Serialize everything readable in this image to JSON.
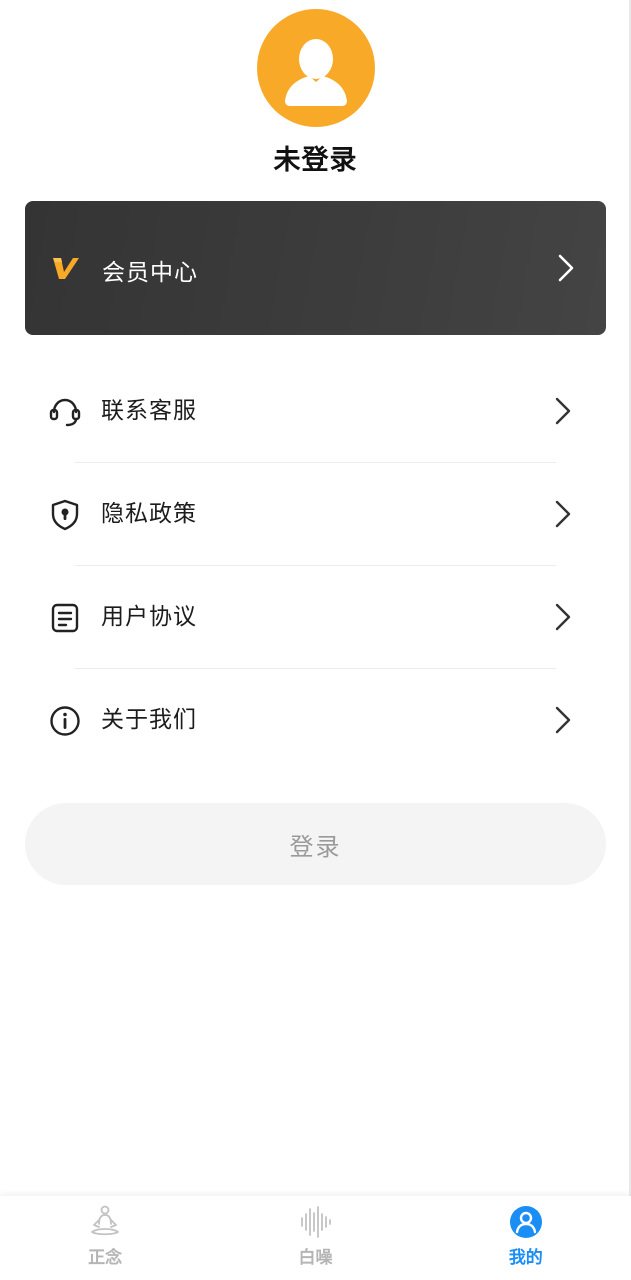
{
  "profile": {
    "username": "未登录"
  },
  "vip": {
    "label": "会员中心",
    "icon": "vip-v-icon",
    "accent": "#f8a928"
  },
  "menu": {
    "items": [
      {
        "label": "联系客服",
        "icon": "headset-icon"
      },
      {
        "label": "隐私政策",
        "icon": "shield-lock-icon"
      },
      {
        "label": "用户协议",
        "icon": "document-icon"
      },
      {
        "label": "关于我们",
        "icon": "info-icon"
      }
    ]
  },
  "login": {
    "label": "登录"
  },
  "tabbar": {
    "tabs": [
      {
        "label": "正念",
        "icon": "meditation-icon",
        "active": false
      },
      {
        "label": "白噪",
        "icon": "soundwave-icon",
        "active": false
      },
      {
        "label": "我的",
        "icon": "user-icon",
        "active": true
      }
    ],
    "active_color": "#1a8ef5",
    "inactive_color": "#b5b5b5"
  }
}
